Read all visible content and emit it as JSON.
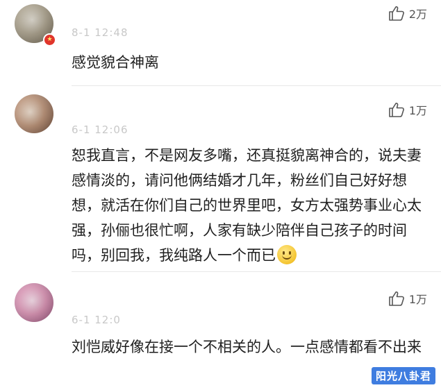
{
  "comments": [
    {
      "meta": "8-1 12:48",
      "likes": "2万",
      "text": "感觉貌合神离",
      "has_badge": true
    },
    {
      "meta": "6-1 12:06",
      "likes": "1万",
      "text_before_emoji": "恕我直言，不是网友多嘴，还真挺貌离神合的，说夫妻感情淡的，请问他俩结婚才几年，粉丝们自己好好想想，就活在你们自己的世界里吧，女方太强势事业心太强，孙俪也很忙啊，人家有缺少陪伴自己孩子的时间吗，别回我，我纯路人一个而已",
      "emoji": "smile-emoji"
    },
    {
      "meta": "6-1 12:0",
      "likes": "1万",
      "text": "刘恺威好像在接一个不相关的人。一点感情都看不出来"
    }
  ],
  "watermark": "阳光八卦君",
  "icons": {
    "like": "thumbs-up-icon",
    "badge": "star-badge-icon"
  },
  "colors": {
    "badge": "#e0352b",
    "watermark_bg": "#3f7de0",
    "meta_text": "#c8c8c8"
  }
}
